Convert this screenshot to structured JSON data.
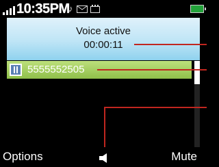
{
  "status_bar": {
    "time": "10:35PM",
    "signal_icon": "signal-strength-icon",
    "music_icon": "music-note-icon",
    "message_icon": "envelope-icon",
    "memory_icon": "memory-card-icon",
    "battery_icon": "battery-icon"
  },
  "call": {
    "status": "Voice active",
    "timer": "00:00:11"
  },
  "contact": {
    "number": "5555552505",
    "icon": "phone-number-icon"
  },
  "softkeys": {
    "left_label": "Options",
    "right_label": "Mute",
    "center_icon": "speaker-icon"
  },
  "colors": {
    "call_panel": "#bfe5f6",
    "number_row": "#9fcc5c",
    "callout": "#c0261f",
    "battery": "#23a23a"
  }
}
